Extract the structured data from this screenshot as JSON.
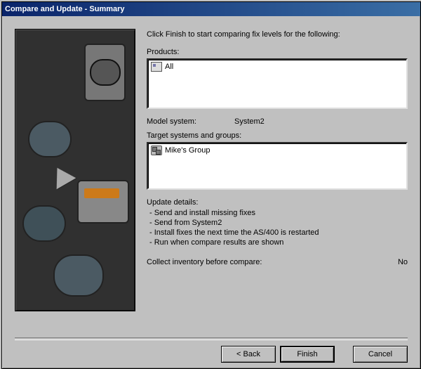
{
  "window": {
    "title": "Compare and Update - Summary"
  },
  "intro": "Click Finish to start comparing fix levels for the following:",
  "products": {
    "heading": "Products:",
    "items": [
      {
        "icon": "server-icon",
        "label": "All"
      }
    ]
  },
  "model_system": {
    "label": "Model system:",
    "value": "System2"
  },
  "targets": {
    "heading": "Target systems and groups:",
    "items": [
      {
        "icon": "group-icon",
        "label": "Mike's Group"
      }
    ]
  },
  "details": {
    "heading": "Update details:",
    "lines": [
      "Send and install missing fixes",
      "Send from System2",
      "Install fixes the next time the AS/400 is restarted",
      "Run when compare results are shown"
    ]
  },
  "inventory": {
    "label": "Collect inventory before compare:",
    "value": "No"
  },
  "buttons": {
    "back": "< Back",
    "finish": "Finish",
    "cancel": "Cancel"
  }
}
